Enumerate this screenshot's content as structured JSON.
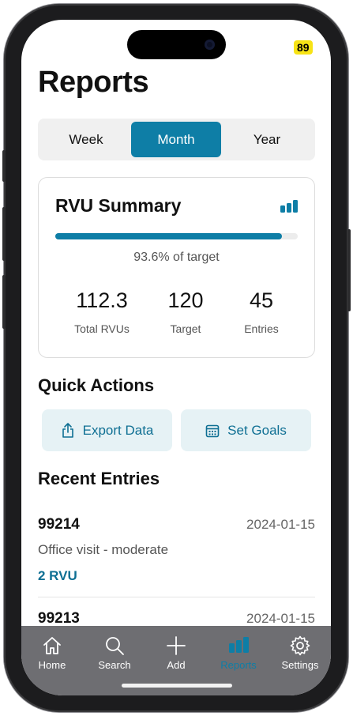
{
  "status": {
    "battery": "89"
  },
  "page": {
    "title": "Reports"
  },
  "segments": [
    {
      "label": "Week",
      "active": false
    },
    {
      "label": "Month",
      "active": true
    },
    {
      "label": "Year",
      "active": false
    }
  ],
  "summary": {
    "title": "RVU Summary",
    "icon": "bar-chart-icon",
    "progress_fraction": 0.936,
    "progress_text": "93.6% of target",
    "stats": [
      {
        "value": "112.3",
        "label": "Total RVUs"
      },
      {
        "value": "120",
        "label": "Target"
      },
      {
        "value": "45",
        "label": "Entries"
      }
    ]
  },
  "quick_actions": {
    "heading": "Quick Actions",
    "items": [
      {
        "label": "Export Data",
        "icon": "share-icon"
      },
      {
        "label": "Set Goals",
        "icon": "calendar-icon"
      }
    ]
  },
  "recent": {
    "heading": "Recent Entries",
    "items": [
      {
        "code": "99214",
        "date": "2024-01-15",
        "description": "Office visit - moderate",
        "rvu": "2 RVU"
      },
      {
        "code": "99213",
        "date": "2024-01-15"
      }
    ]
  },
  "tabbar": {
    "items": [
      {
        "label": "Home",
        "icon": "home-icon"
      },
      {
        "label": "Search",
        "icon": "search-icon"
      },
      {
        "label": "Add",
        "icon": "plus-icon"
      },
      {
        "label": "Reports",
        "icon": "bar-chart-icon",
        "active": true
      },
      {
        "label": "Settings",
        "icon": "gear-icon"
      }
    ]
  },
  "colors": {
    "accent": "#0e7ea6",
    "accent_text": "#0e6f93",
    "tab_bar": "#6e6e72",
    "action_bg": "#e6f2f5"
  }
}
